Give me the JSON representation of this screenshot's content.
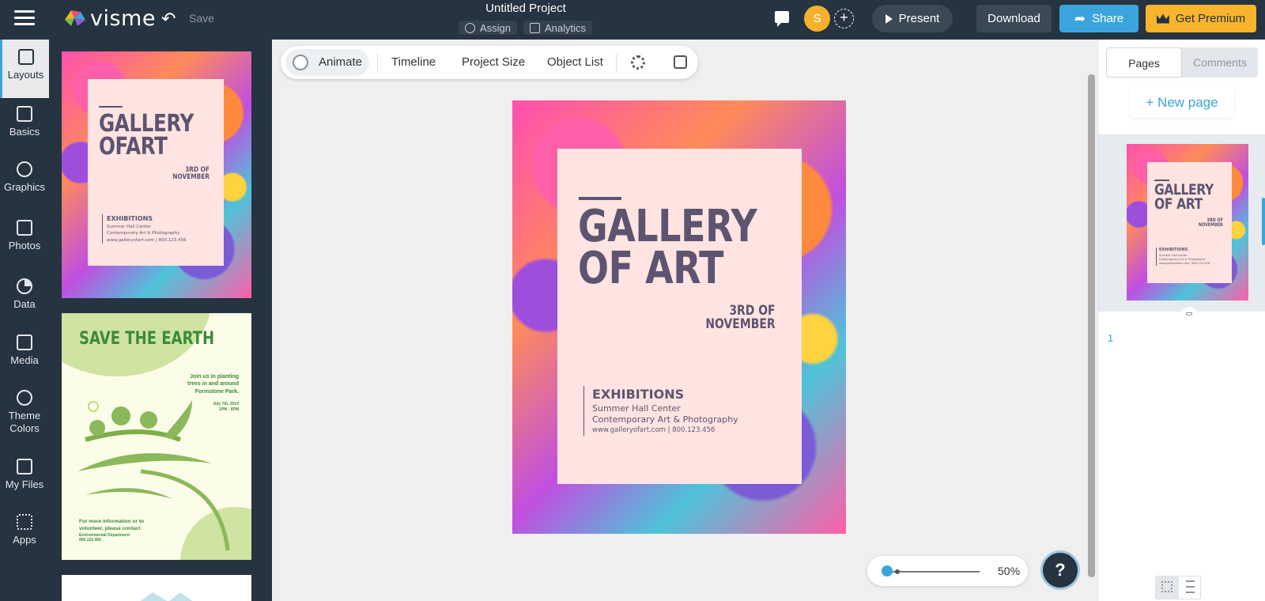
{
  "header": {
    "logo_text": "visme",
    "save_label": "Save",
    "project_title": "Untitled Project",
    "assign_label": "Assign",
    "analytics_label": "Analytics",
    "avatar_initial": "S",
    "present_label": "Present",
    "download_label": "Download",
    "share_label": "Share",
    "premium_label": "Get Premium"
  },
  "sidebar": {
    "items": [
      {
        "label": "Layouts",
        "icon": "layouts-icon"
      },
      {
        "label": "Basics",
        "icon": "basics-icon"
      },
      {
        "label": "Graphics",
        "icon": "graphics-icon"
      },
      {
        "label": "Photos",
        "icon": "photos-icon"
      },
      {
        "label": "Data",
        "icon": "data-icon"
      },
      {
        "label": "Media",
        "icon": "media-icon"
      },
      {
        "label": "Theme Colors",
        "icon": "palette-icon"
      },
      {
        "label": "My Files",
        "icon": "my-files-icon"
      },
      {
        "label": "Apps",
        "icon": "apps-icon"
      }
    ]
  },
  "templates": {
    "gallery": {
      "title_line1": "GALLERY",
      "title_line2": "OFART",
      "date_line1": "3RD OF",
      "date_line2": "NOVEMBER",
      "info_heading": "EXHIBITIONS",
      "info_line1": "Summer Hall Center",
      "info_line2": "Contemporary Art & Photography",
      "info_line3": "www.galleryofart.com | 800.123.456"
    },
    "earth": {
      "title": "SAVE THE EARTH",
      "blurb_line1": "Join us in planting",
      "blurb_line2": "trees in and around",
      "blurb_line3": "Formstone Park.",
      "date_line1": "July 7th, 2019",
      "date_line2": "1PM - 6PM",
      "contact_line1": "For more information or to",
      "contact_line2": "volunteer, please contact",
      "contact_line3": "Environmental Department",
      "contact_line4": "800.123.456"
    }
  },
  "toolbar": {
    "animate_label": "Animate",
    "timeline_label": "Timeline",
    "project_size_label": "Project Size",
    "object_list_label": "Object List"
  },
  "canvas": {
    "title_line1": "GALLERY",
    "title_line2": "OF ART",
    "date_line1": "3RD OF",
    "date_line2": "NOVEMBER",
    "info_heading": "EXHIBITIONS",
    "info_line1": "Summer Hall Center",
    "info_line2": "Contemporary Art & Photography",
    "info_line3": "www.galleryofart.com | 800.123.456"
  },
  "zoom": {
    "value_label": "50%",
    "level": 0.5
  },
  "help_label": "?",
  "pages_panel": {
    "tab_pages": "Pages",
    "tab_comments": "Comments",
    "new_page_label": "+ New page",
    "page_number": "1",
    "thumb": {
      "title_line1": "GALLERY",
      "title_line2": "OF ART",
      "date_line1": "3RD OF",
      "date_line2": "NOVEMBER",
      "info_heading": "EXHIBITIONS",
      "info_line1": "Summer Hall Center",
      "info_line2": "Contemporary Art & Photography",
      "info_line3": "www.galleryofart.com | 800.123.456"
    }
  },
  "colors": {
    "nav_bg": "#263340",
    "accent_blue": "#3aa5dc",
    "premium_yellow": "#f7b42c",
    "poster_card": "#ffe4e1",
    "poster_text": "#5c5470",
    "earth_green": "#3d8a3a"
  }
}
